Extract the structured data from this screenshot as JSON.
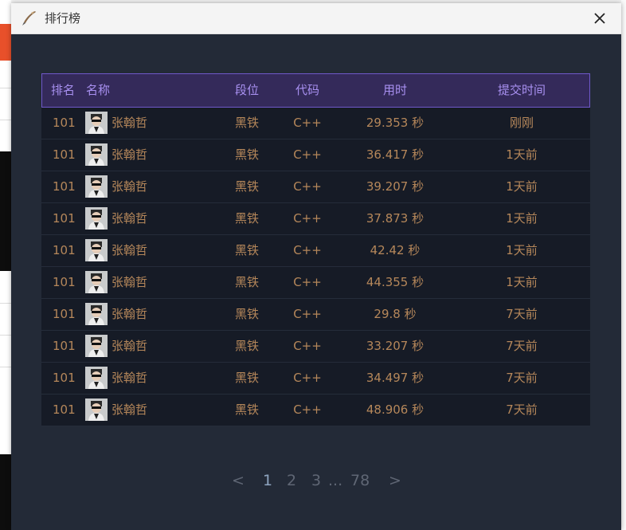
{
  "window": {
    "title": "排行榜",
    "title_icon": "quill-pen-icon",
    "close_icon": "close-icon"
  },
  "table": {
    "headers": {
      "rank": "排名",
      "name": "名称",
      "tier": "段位",
      "lang": "代码",
      "time": "用时",
      "submitted": "提交时间"
    },
    "rows": [
      {
        "rank": "101",
        "name": "张翰哲",
        "tier": "黑铁",
        "lang": "C++",
        "time": "29.353 秒",
        "submitted": "刚刚"
      },
      {
        "rank": "101",
        "name": "张翰哲",
        "tier": "黑铁",
        "lang": "C++",
        "time": "36.417 秒",
        "submitted": "1天前"
      },
      {
        "rank": "101",
        "name": "张翰哲",
        "tier": "黑铁",
        "lang": "C++",
        "time": "39.207 秒",
        "submitted": "1天前"
      },
      {
        "rank": "101",
        "name": "张翰哲",
        "tier": "黑铁",
        "lang": "C++",
        "time": "37.873 秒",
        "submitted": "1天前"
      },
      {
        "rank": "101",
        "name": "张翰哲",
        "tier": "黑铁",
        "lang": "C++",
        "time": "42.42 秒",
        "submitted": "1天前"
      },
      {
        "rank": "101",
        "name": "张翰哲",
        "tier": "黑铁",
        "lang": "C++",
        "time": "44.355 秒",
        "submitted": "1天前"
      },
      {
        "rank": "101",
        "name": "张翰哲",
        "tier": "黑铁",
        "lang": "C++",
        "time": "29.8 秒",
        "submitted": "7天前"
      },
      {
        "rank": "101",
        "name": "张翰哲",
        "tier": "黑铁",
        "lang": "C++",
        "time": "33.207 秒",
        "submitted": "7天前"
      },
      {
        "rank": "101",
        "name": "张翰哲",
        "tier": "黑铁",
        "lang": "C++",
        "time": "34.497 秒",
        "submitted": "7天前"
      },
      {
        "rank": "101",
        "name": "张翰哲",
        "tier": "黑铁",
        "lang": "C++",
        "time": "48.906 秒",
        "submitted": "7天前"
      }
    ]
  },
  "pagination": {
    "prev": "<",
    "pages": [
      "1",
      "2",
      "3"
    ],
    "ellipsis": "...",
    "last": "78",
    "next": ">",
    "current": "1"
  },
  "colors": {
    "dialog_bg": "#232a37",
    "header_bg": "#342a5a",
    "header_border": "#6f58c9",
    "header_text": "#a890f0",
    "row_bg": "#161b26",
    "row_text": "#b5875a"
  }
}
